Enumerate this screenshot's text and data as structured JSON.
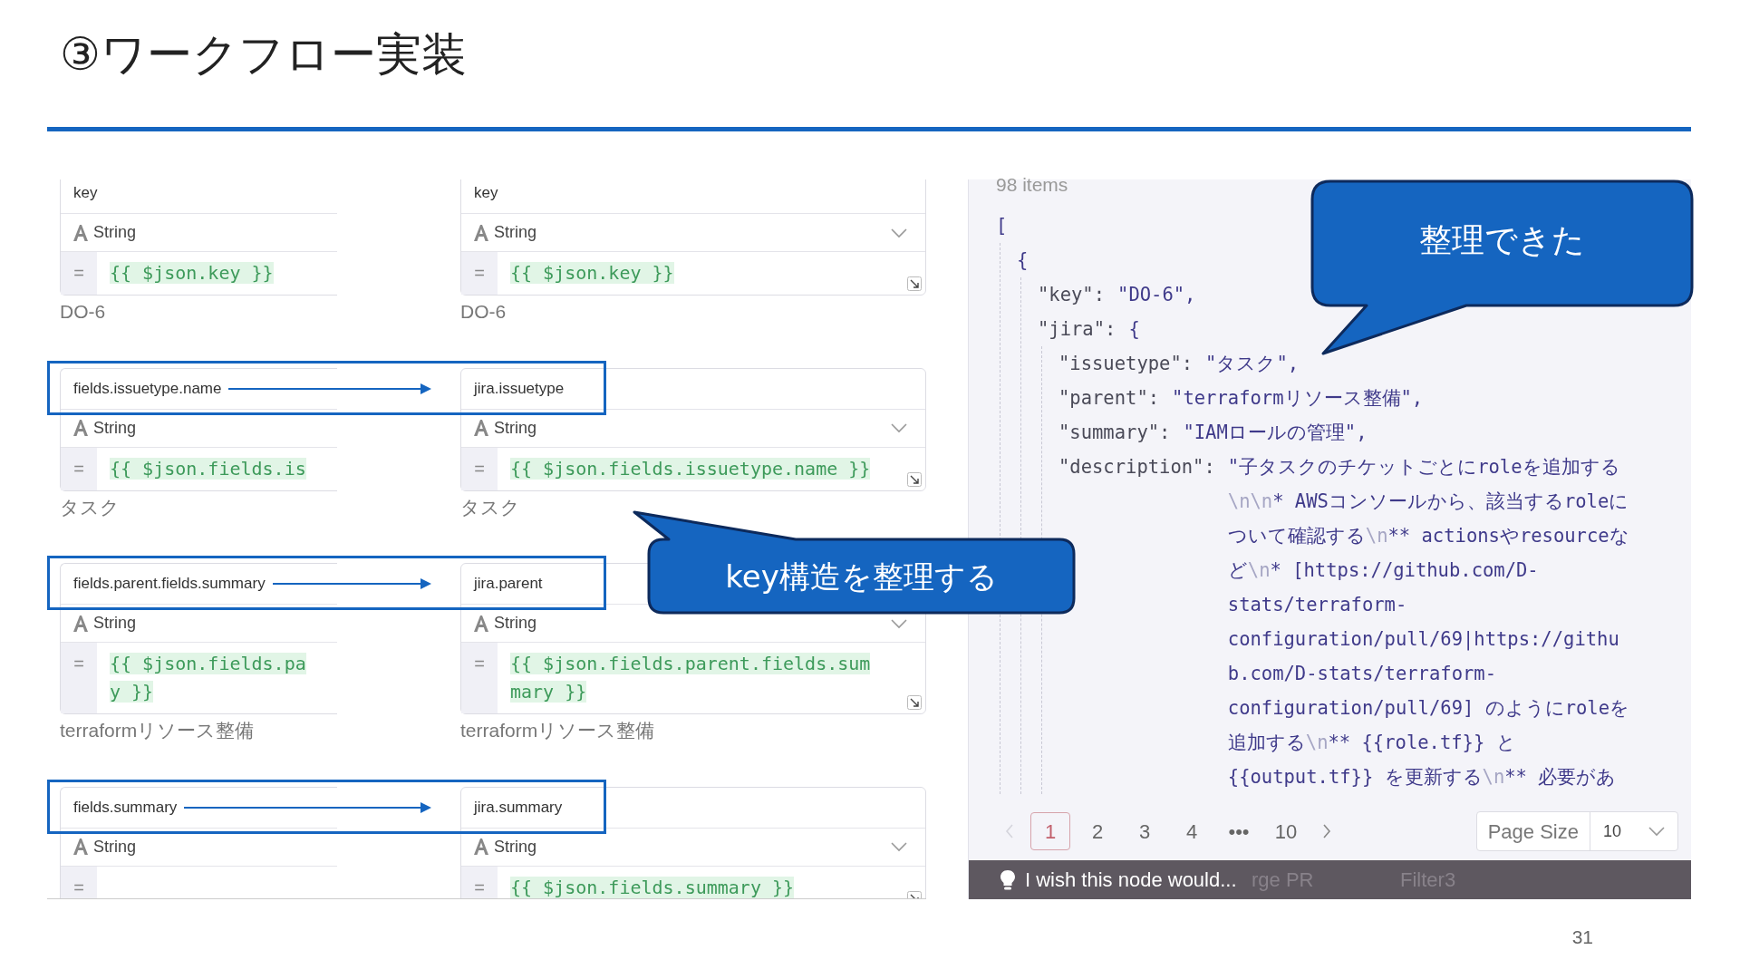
{
  "slide": {
    "title": "③ワークフロー実装",
    "page_number": "31"
  },
  "field_mapping": {
    "groups": [
      {
        "highlighted": false,
        "source": {
          "name": "key",
          "type": "String",
          "operator": "=",
          "expression": [
            "{{ $json.key }}"
          ],
          "result": "DO-6"
        },
        "target": {
          "name": "key",
          "type": "String",
          "operator": "=",
          "expression": [
            "{{ $json.key }}"
          ],
          "result": "DO-6"
        }
      },
      {
        "highlighted": true,
        "source": {
          "name": "fields.issuetype.name",
          "type": "String",
          "operator": "=",
          "expression": [
            "{{ $json.fields.is"
          ],
          "result": "タスク"
        },
        "target": {
          "name": "jira.issuetype",
          "type": "String",
          "operator": "=",
          "expression": [
            "{{ $json.fields.issuetype.name }}"
          ],
          "result": "タスク"
        }
      },
      {
        "highlighted": true,
        "source": {
          "name": "fields.parent.fields.summary",
          "type": "String",
          "operator": "=",
          "expression": [
            "{{ $json.fields.pa",
            "y }}"
          ],
          "result": "terraformリソース整備"
        },
        "target": {
          "name": "jira.parent",
          "type": "String",
          "operator": "=",
          "expression": [
            "{{ $json.fields.parent.fields.sum",
            "mary }}"
          ],
          "result": "terraformリソース整備"
        }
      },
      {
        "highlighted": true,
        "source": {
          "name": "fields.summary",
          "type": "String",
          "operator": "="
        },
        "target": {
          "name": "jira.summary",
          "type": "String",
          "operator": "=",
          "expression": [
            "{{ $json.fields.summary }}"
          ]
        }
      }
    ]
  },
  "output_panel": {
    "item_count": "98 items",
    "json_tree": [
      {
        "text": "[",
        "children": [
          {
            "text": "{",
            "children": [
              {
                "key": "\"key\":",
                "value": "\"DO-6\","
              },
              {
                "key": "\"jira\":",
                "value": "{",
                "children": [
                  {
                    "key": "\"issuetype\":",
                    "value": "\"タスク\","
                  },
                  {
                    "key": "\"parent\":",
                    "value": "\"terraformリソース整備\","
                  },
                  {
                    "key": "\"summary\":",
                    "value": "\"IAMロールの管理\","
                  },
                  {
                    "key": "\"description\":",
                    "value_lines": [
                      [
                        {
                          "kind": "text",
                          "text": "\"子タスクのチケットごとにroleを追加する"
                        }
                      ],
                      [
                        {
                          "kind": "escape",
                          "text": "\\n\\n"
                        },
                        {
                          "kind": "text",
                          "text": "* AWSコンソールから、該当するroleに"
                        }
                      ],
                      [
                        {
                          "kind": "text",
                          "text": "ついて確認する"
                        },
                        {
                          "kind": "escape",
                          "text": "\\n"
                        },
                        {
                          "kind": "text",
                          "text": "** actionsやresourceな"
                        }
                      ],
                      [
                        {
                          "kind": "text",
                          "text": "ど"
                        },
                        {
                          "kind": "escape",
                          "text": "\\n"
                        },
                        {
                          "kind": "text",
                          "text": "* [https://github.com/D-"
                        }
                      ],
                      [
                        {
                          "kind": "text",
                          "text": "stats/terraform-"
                        }
                      ],
                      [
                        {
                          "kind": "text",
                          "text": "configuration/pull/69|https://githu"
                        }
                      ],
                      [
                        {
                          "kind": "text",
                          "text": "b.com/D-stats/terraform-"
                        }
                      ],
                      [
                        {
                          "kind": "text",
                          "text": "configuration/pull/69] のようにroleを"
                        }
                      ],
                      [
                        {
                          "kind": "text",
                          "text": "追加する"
                        },
                        {
                          "kind": "escape",
                          "text": "\\n"
                        },
                        {
                          "kind": "text",
                          "text": "** {{role.tf}} と"
                        }
                      ],
                      [
                        {
                          "kind": "text",
                          "text": "{{output.tf}} を更新する"
                        },
                        {
                          "kind": "escape",
                          "text": "\\n"
                        },
                        {
                          "kind": "text",
                          "text": "** 必要があ"
                        }
                      ]
                    ]
                  }
                ]
              }
            ]
          }
        ]
      }
    ],
    "pagination": {
      "previous": {
        "disabled": true
      },
      "next": {
        "disabled": false
      },
      "pages": [
        {
          "label": "1",
          "selected": true
        },
        {
          "label": "2",
          "selected": false
        },
        {
          "label": "3",
          "selected": false
        },
        {
          "label": "4",
          "selected": false
        },
        {
          "label": "•••",
          "selected": false
        },
        {
          "label": "10",
          "selected": false
        }
      ],
      "page_size": {
        "label": "Page Size",
        "value": "10"
      }
    }
  },
  "canvas_bar": {
    "toast": "I wish this node would...",
    "node_labels": [
      "rge PR",
      "Filter3"
    ]
  },
  "callouts": [
    {
      "text": "整理できた"
    },
    {
      "text": "key構造を整理する"
    }
  ]
}
